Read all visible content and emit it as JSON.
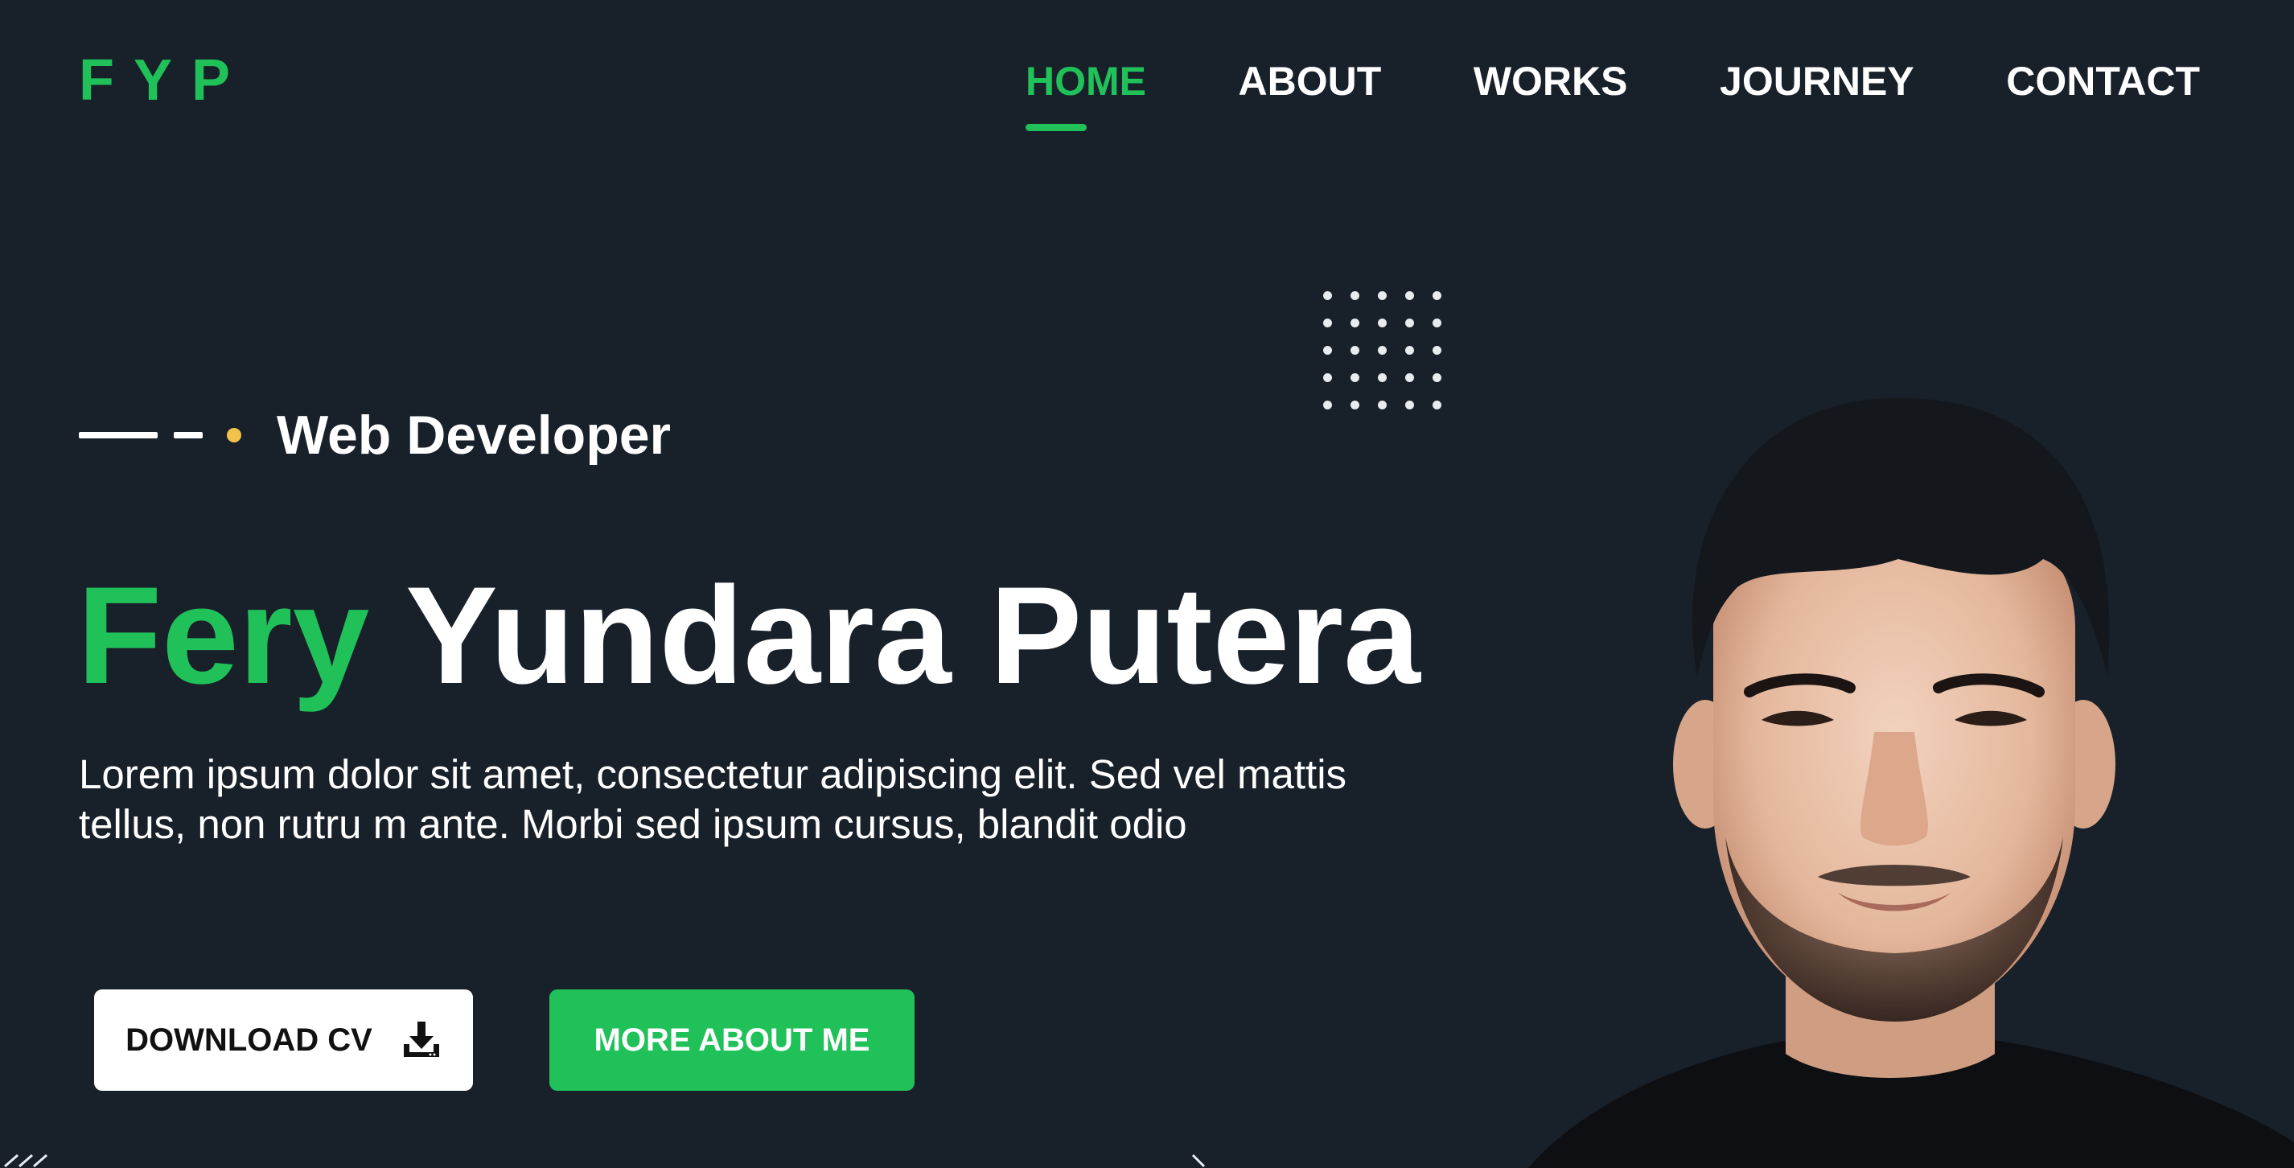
{
  "brand": {
    "logo_text": "FYP",
    "accent_color": "#21c15a",
    "background_color": "#18202a"
  },
  "nav": {
    "items": [
      {
        "label": "HOME",
        "active": true
      },
      {
        "label": "ABOUT",
        "active": false
      },
      {
        "label": "WORKS",
        "active": false
      },
      {
        "label": "JOURNEY",
        "active": false
      },
      {
        "label": "CONTACT",
        "active": false
      }
    ]
  },
  "hero": {
    "tagline": "Web Developer",
    "name_first": "Fery",
    "name_rest": "Yundara Putera",
    "description": "Lorem ipsum dolor sit amet, consectetur adipiscing elit. Sed vel mattis tellus, non rutru m ante. Morbi sed ipsum cursus, blandit odio"
  },
  "buttons": {
    "download_cv": "DOWNLOAD CV",
    "download_icon": "download-icon",
    "more_about": "MORE ABOUT ME"
  },
  "decor": {
    "dot_grid": "dot-pattern",
    "tagline_marker_color": "#f3c24a"
  },
  "portrait": {
    "description_icon": "portrait-photo"
  }
}
